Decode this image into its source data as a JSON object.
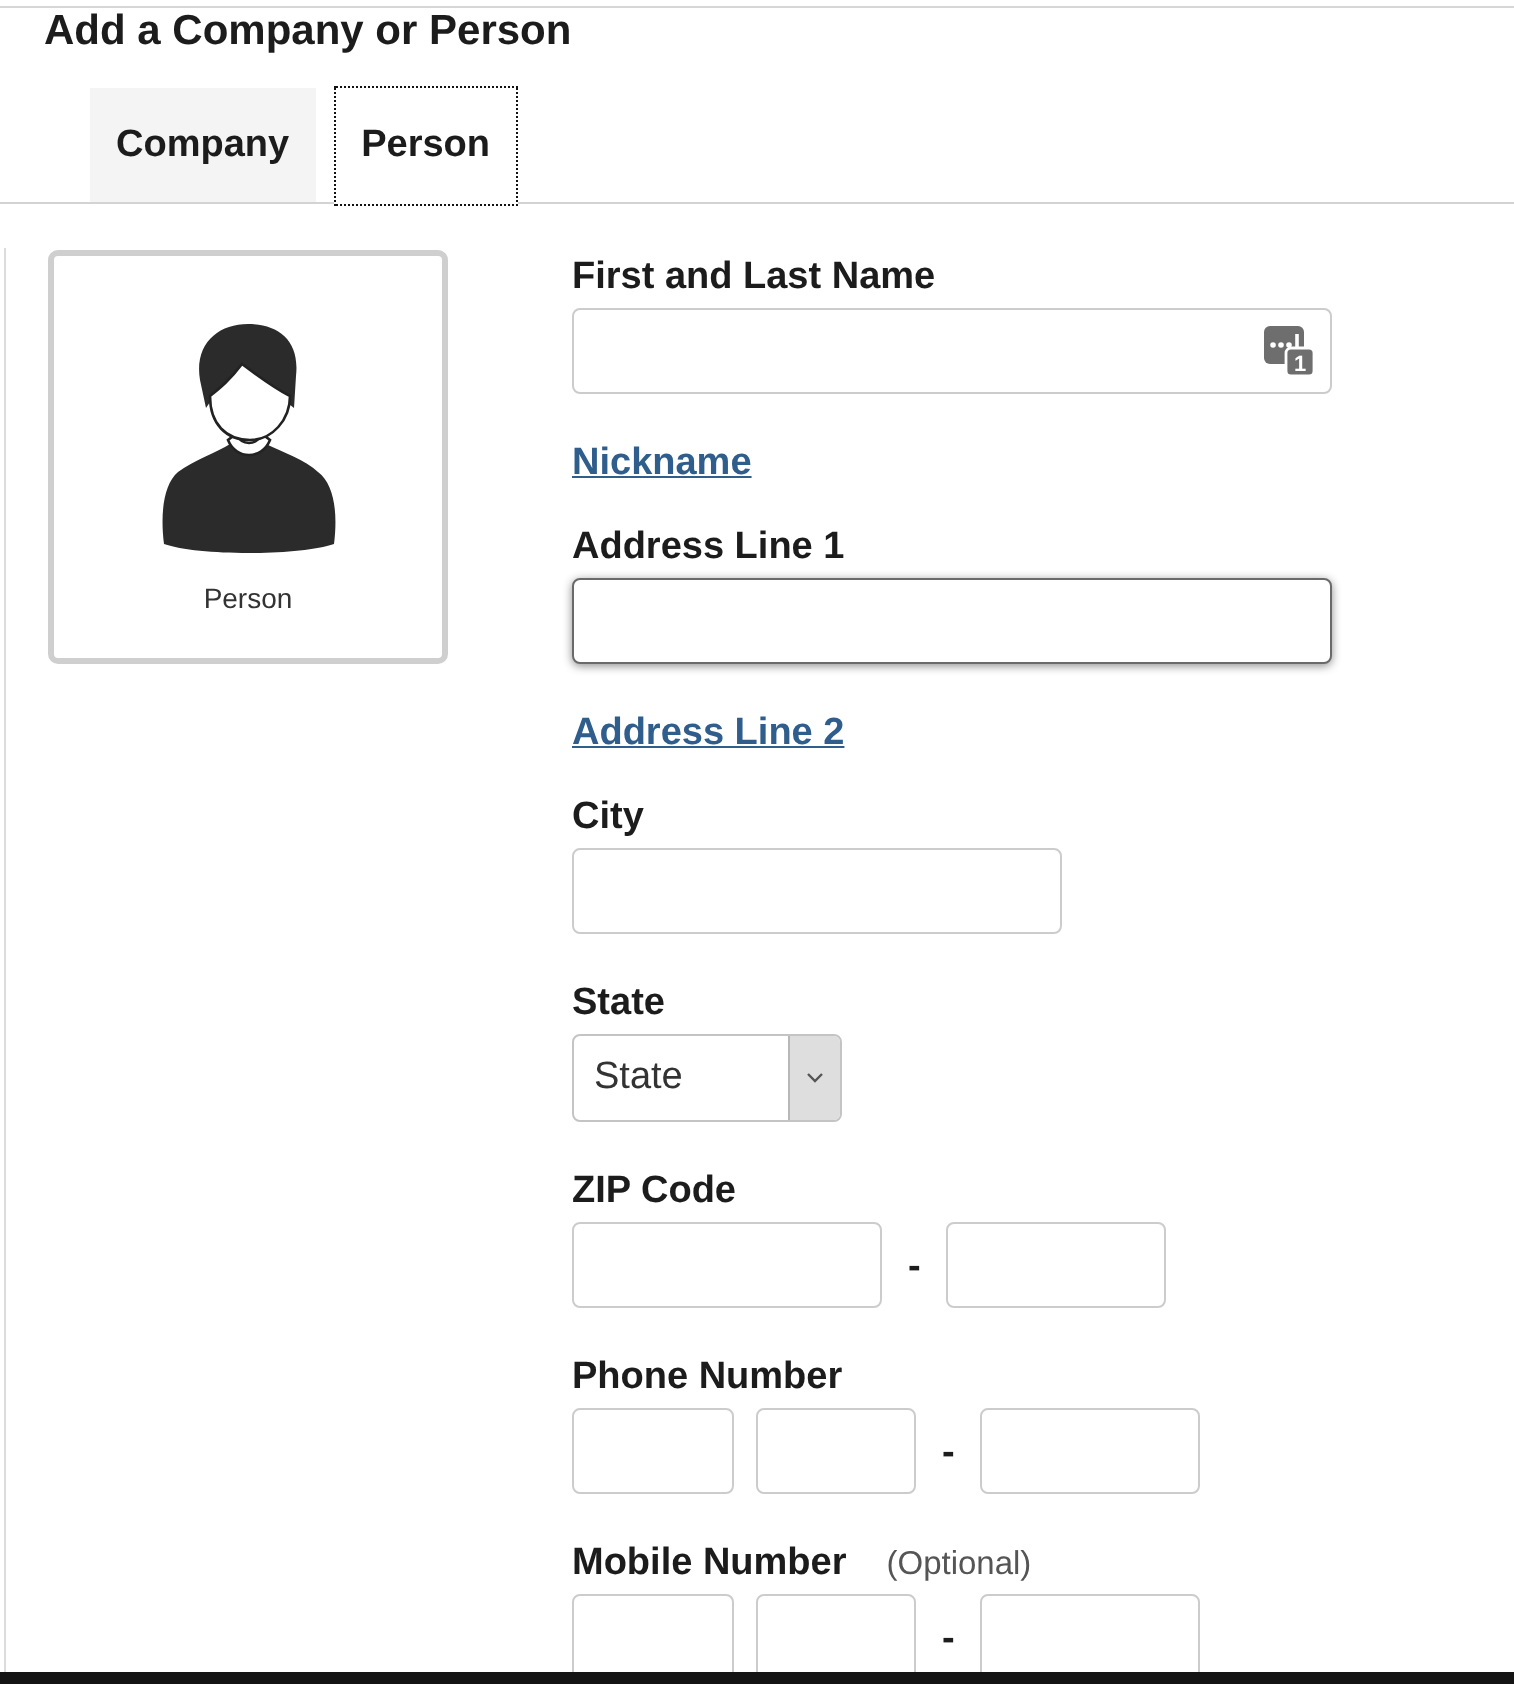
{
  "header": {
    "title": "Add a Company or Person"
  },
  "tabs": [
    {
      "label": "Company",
      "selected": false
    },
    {
      "label": "Person",
      "selected": true
    }
  ],
  "profile_card": {
    "caption": "Person"
  },
  "form": [
    {
      "kind": "text",
      "label": "First and Last Name",
      "focused": false,
      "badge": "1"
    },
    {
      "kind": "link",
      "label": "Nickname"
    },
    {
      "kind": "text",
      "label": "Address Line 1",
      "focused": true
    },
    {
      "kind": "link",
      "label": "Address Line 2"
    },
    {
      "kind": "short_text",
      "label": "City",
      "focused": false
    },
    {
      "kind": "select",
      "label": "State",
      "value": "State"
    },
    {
      "kind": "zip",
      "label": "ZIP Code",
      "separator": "-"
    },
    {
      "kind": "phone",
      "label": "Phone Number",
      "separator": "-"
    },
    {
      "kind": "phone",
      "label": "Mobile Number",
      "note": "(Optional)",
      "separator": "-"
    }
  ]
}
